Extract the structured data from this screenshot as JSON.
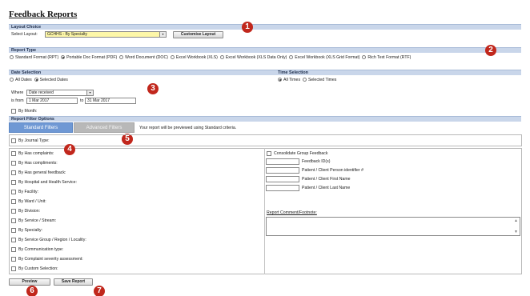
{
  "page": {
    "title": "Feedback Reports"
  },
  "layout_choice": {
    "header": "Layout Choice",
    "label": "Select Layout:",
    "selected": "GCHHS - By Specialty",
    "customise_button": "Customise Layout"
  },
  "report_type": {
    "header": "Report Type",
    "options": [
      {
        "label": "Standard Format (RPT)",
        "selected": false
      },
      {
        "label": "Portable Doc Format (PDF)",
        "selected": true
      },
      {
        "label": "Word Document (DOC)",
        "selected": false
      },
      {
        "label": "Excel Workbook (XLS)",
        "selected": false
      },
      {
        "label": "Excel Workbook (XLS Data Only)",
        "selected": false
      },
      {
        "label": "Excel Workbook (XLS Grid Format)",
        "selected": false
      },
      {
        "label": "Rich Text Format (RTF)",
        "selected": false
      }
    ]
  },
  "date_selection": {
    "header": "Date Selection",
    "all_dates": "All Dates",
    "selected_dates": "Selected Dates",
    "where_label": "Where",
    "where_value": "Date received",
    "from_label": "is from",
    "from_value": "1 Mar 2017",
    "to_label": "to",
    "to_value": "31 Mar 2017",
    "by_month": "By Month:"
  },
  "time_selection": {
    "header": "Time Selection",
    "all_times": "All Times",
    "selected_times": "Selected Times"
  },
  "filter_options": {
    "header": "Report Filter Options",
    "standard_tab": "Standard Filters",
    "advanced_tab": "Advanced Filters",
    "preview_note": "Your report will be previewed using Standard criteria.",
    "journal_type": "By Journal Type:",
    "filters": [
      "By Has complaints:",
      "By Has compliments:",
      "By Has general feedback:",
      "By Hospital and Health Service:",
      "By Facility:",
      "By Ward / Unit:",
      "By Division:",
      "By Service / Stream:",
      "By Specialty:",
      "By Service Group / Region / Locality:",
      "By Communication type:",
      "By Complaint severity assessment:",
      "By Custom Selection:"
    ],
    "consolidate": "Consolidate Group Feedback",
    "id_fields": [
      "Feedback ID(s)",
      "Patient / Client Person identifier #",
      "Patient / Client First Name",
      "Patient / Client Last Name"
    ],
    "comment_label": "Report Comment/Footnote:"
  },
  "actions": {
    "preview": "Preview",
    "save": "Save Report"
  },
  "markers": [
    "1",
    "2",
    "3",
    "4",
    "5",
    "6",
    "7"
  ],
  "colors": {
    "marker": "#c1271c",
    "section_bar": "#c9d6ea",
    "active_tab": "#6f98d4",
    "layout_select": "#fdf7a8"
  }
}
